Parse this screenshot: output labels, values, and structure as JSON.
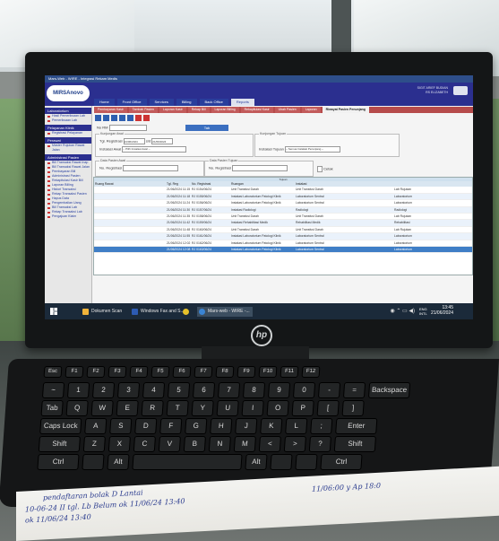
{
  "app": {
    "window_title": "Mars-Web - WIRE - Integrasi Rekam Medis",
    "logo_text": "MIRSAnovo",
    "nav_items": [
      "Home",
      "Front Office",
      "Services",
      "Billing",
      "Back Office",
      "Reports"
    ],
    "active_nav_index": 5,
    "user_info": [
      "SIGIT ARIEF BUDIAN",
      "RS ELIZABETH"
    ],
    "header_code": "21/06/2024"
  },
  "sidebar": {
    "sections": [
      {
        "title": "Laboratorium",
        "items": [
          "Hasil Pemeriksaan Lab",
          "Pemeriksaan Lab"
        ]
      },
      {
        "title": "Pelayanan Klinik",
        "items": [
          "Registrasi Pelayanan"
        ]
      },
      {
        "title": "Perawat",
        "items": [
          "Master Rujukan Rawat Jalan"
        ]
      },
      {
        "title": "Administrasi Pasien",
        "items": [
          "Bill Transaksi Rawat Inap",
          "Bill Transaksi Rawat Jalan",
          "Pembayaran Bill",
          "Administrasi Pasien",
          "Rekapitulasi Kasir Bill",
          "Laporan Billing",
          "Histori Transaksi",
          "Rekap Transaksi Pasien",
          "Hapus Data",
          "Pengembalian Uang",
          "Bill Transaksi Lab",
          "Rekap Transaksi Lab",
          "Pengajuan Klaim"
        ]
      }
    ]
  },
  "subtabs": [
    "Pembayaran Kasir",
    "Tambah Pasien",
    "Laporan Kasir",
    "Rekap Bill",
    "Laporan Billing",
    "Rekapitulasi Kasir",
    "Ubah Pasien",
    "Laporan",
    "Riwayat Pasien Penunjang"
  ],
  "active_subtab_index": 8,
  "form": {
    "no_rm_label": "No RM",
    "tab_button": "Tab",
    "kunjungan_awal": "Kunjungan Awal",
    "kunjungan_tujuan": "Kunjungan Tujuan",
    "tgl_registrasi_label": "Tgl. Registrasi",
    "sd_label": "s/d",
    "date_from": "21/06/2024",
    "date_to": "21/06/2024",
    "instalasi_awal_label": "Instalasi Awal",
    "instalasi_awal_value": "-- Pilih Instalasi Awal --",
    "instalasi_tujuan_label": "Instalasi Tujuan",
    "instalasi_tujuan_value": "-- Semua Instalasi Penunjang --",
    "data_pasien_awal": "Data Pasien Awal",
    "data_pasien_tujuan": "Data Pasien Tujuan",
    "no_registrasi_label": "No. Registrasi",
    "cetak_label": "Cetak"
  },
  "grid": {
    "title": "Tujuan",
    "columns": [
      "Ruang Rawat",
      "Tgl. Reg",
      "No. Registrasi",
      "Ruangan",
      "Instalasi",
      "",
      ""
    ],
    "rows": [
      [
        "",
        "21/06/2024 11:15",
        "RJ 0154/06/24",
        "Unit Transfusi Darah",
        "Unit Transfusi Darah",
        "Lab Rujukan"
      ],
      [
        "",
        "21/06/2024 11:18",
        "RJ 0155/06/24",
        "Instalasi Laboratorium Patologi Klinik",
        "Laboratorium Sentral",
        "Laboratorium"
      ],
      [
        "",
        "21/06/2024 11:24",
        "RJ 0156/06/24",
        "Instalasi Laboratorium Patologi Klinik",
        "Laboratorium Sentral",
        "Laboratorium"
      ],
      [
        "",
        "21/06/2024 11:30",
        "RJ 0157/06/24",
        "Instalasi Radiologi",
        "Radiologi",
        "Radiologi"
      ],
      [
        "",
        "21/06/2024 11:35",
        "RJ 0158/06/24",
        "Unit Transfusi Darah",
        "Unit Transfusi Darah",
        "Lab Rujukan"
      ],
      [
        "",
        "21/06/2024 11:42",
        "RJ 0159/06/24",
        "Instalasi Rehabilitasi Medik",
        "Rehabilitasi Medik",
        "Rehabilitasi"
      ],
      [
        "",
        "21/06/2024 11:48",
        "RJ 0160/06/24",
        "Unit Transfusi Darah",
        "Unit Transfusi Darah",
        "Lab Rujukan"
      ],
      [
        "",
        "21/06/2024 11:55",
        "RJ 0161/06/24",
        "Instalasi Laboratorium Patologi Klinik",
        "Laboratorium Sentral",
        "Laboratorium"
      ],
      [
        "",
        "21/06/2024 12:02",
        "RJ 0162/06/24",
        "Instalasi Laboratorium Patologi Klinik",
        "Laboratorium Sentral",
        "Laboratorium"
      ],
      [
        "",
        "21/06/2024 12:08",
        "RJ 0163/06/24",
        "Instalasi Laboratorium Patologi Klinik",
        "Laboratorium Sentral",
        "Laboratorium"
      ]
    ],
    "selected_row_index": 9
  },
  "taskbar": {
    "apps": [
      "Dokumen Scan",
      "Windows Fax and S...",
      "",
      "Mars-web - WIRE -..."
    ],
    "clock_time": "13:45",
    "clock_date": "21/06/2024",
    "lang": "ENG INTL"
  },
  "monitor_brand": "hp",
  "keyboard": {
    "row1": [
      "Esc",
      "F1",
      "F2",
      "F3",
      "F4",
      "F5",
      "F6",
      "F7",
      "F8",
      "F9",
      "F10",
      "F11",
      "F12"
    ],
    "row2": [
      "~",
      "1",
      "2",
      "3",
      "4",
      "5",
      "6",
      "7",
      "8",
      "9",
      "0",
      "-",
      "=",
      "Backspace"
    ],
    "row3": [
      "Tab",
      "Q",
      "W",
      "E",
      "R",
      "T",
      "Y",
      "U",
      "I",
      "O",
      "P",
      "[",
      "]"
    ],
    "row4": [
      "Caps Lock",
      "A",
      "S",
      "D",
      "F",
      "G",
      "H",
      "J",
      "K",
      "L",
      ";",
      "Enter"
    ],
    "row5": [
      "Shift",
      "Z",
      "X",
      "C",
      "V",
      "B",
      "N",
      "M",
      "<",
      ">",
      "?",
      "Shift"
    ],
    "row6": [
      "Ctrl",
      "",
      "Alt",
      "",
      "Alt",
      "",
      "",
      "Ctrl"
    ]
  },
  "notebook": {
    "lines": [
      "pendaftaran bolak D Lantai",
      "10-06-24 II  tgl. Lb  Belum  ok  11/06/24  13:40",
      "                  ok  11/06/24  13:40",
      "11/06:00     y    Ap    18:0"
    ]
  }
}
